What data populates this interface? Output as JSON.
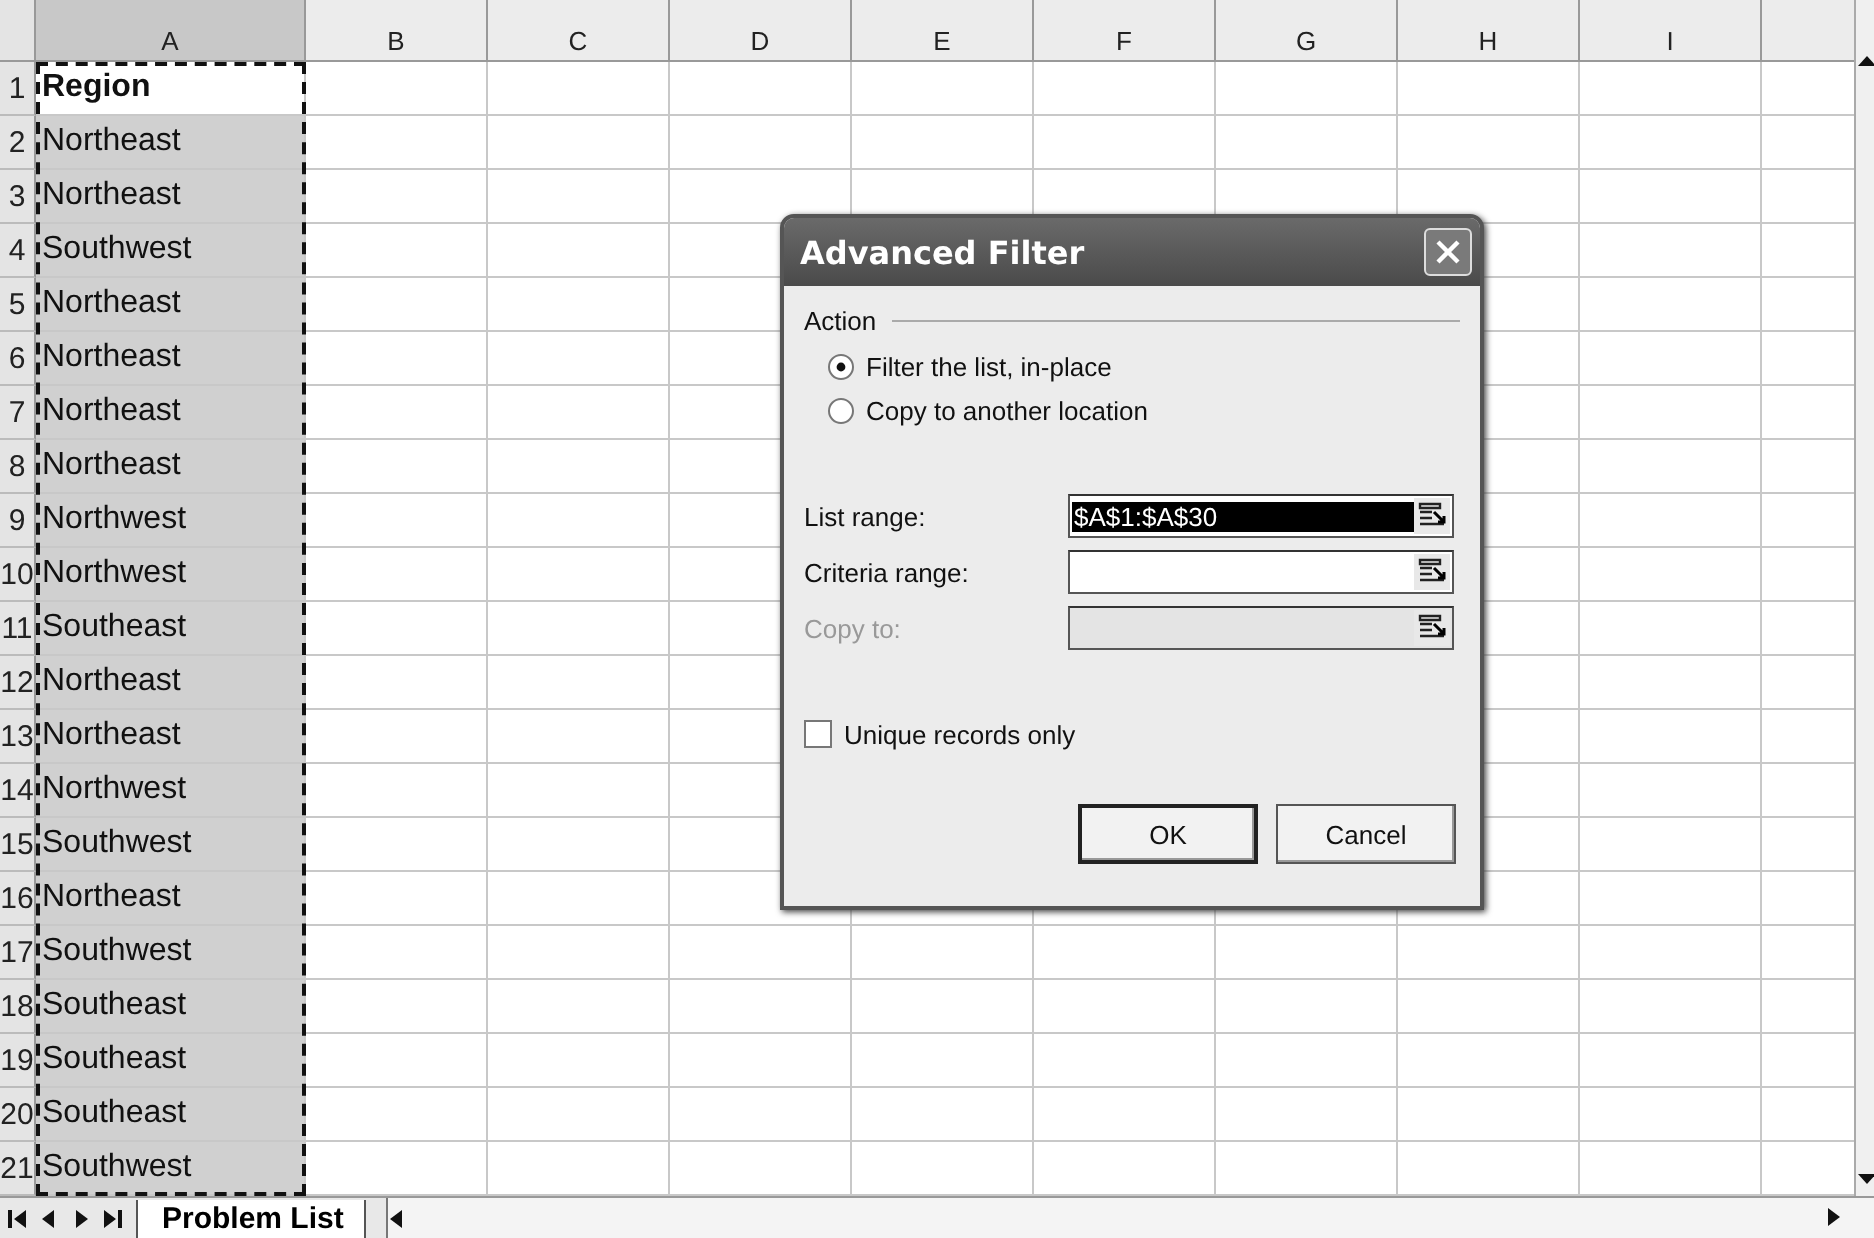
{
  "columns": [
    {
      "label": "A",
      "selected": true
    },
    {
      "label": "B",
      "selected": false
    },
    {
      "label": "C",
      "selected": false
    },
    {
      "label": "D",
      "selected": false
    },
    {
      "label": "E",
      "selected": false
    },
    {
      "label": "F",
      "selected": false
    },
    {
      "label": "G",
      "selected": false
    },
    {
      "label": "H",
      "selected": false
    },
    {
      "label": "I",
      "selected": false
    }
  ],
  "rows": [
    {
      "number": "1",
      "value": "Region",
      "kind": "header",
      "highlighted": false
    },
    {
      "number": "2",
      "value": "Northeast",
      "kind": "data",
      "highlighted": true
    },
    {
      "number": "3",
      "value": "Northeast",
      "kind": "data",
      "highlighted": true
    },
    {
      "number": "4",
      "value": "Southwest",
      "kind": "data",
      "highlighted": true
    },
    {
      "number": "5",
      "value": "Northeast",
      "kind": "data",
      "highlighted": true
    },
    {
      "number": "6",
      "value": "Northeast",
      "kind": "data",
      "highlighted": true
    },
    {
      "number": "7",
      "value": "Northeast",
      "kind": "data",
      "highlighted": true
    },
    {
      "number": "8",
      "value": "Northeast",
      "kind": "data",
      "highlighted": true
    },
    {
      "number": "9",
      "value": "Northwest",
      "kind": "data",
      "highlighted": true
    },
    {
      "number": "10",
      "value": "Northwest",
      "kind": "data",
      "highlighted": true
    },
    {
      "number": "11",
      "value": "Southeast",
      "kind": "data",
      "highlighted": true
    },
    {
      "number": "12",
      "value": "Northeast",
      "kind": "data",
      "highlighted": true
    },
    {
      "number": "13",
      "value": "Northeast",
      "kind": "data",
      "highlighted": true
    },
    {
      "number": "14",
      "value": "Northwest",
      "kind": "data",
      "highlighted": true
    },
    {
      "number": "15",
      "value": "Southwest",
      "kind": "data",
      "highlighted": true
    },
    {
      "number": "16",
      "value": "Northeast",
      "kind": "data",
      "highlighted": true
    },
    {
      "number": "17",
      "value": "Southwest",
      "kind": "data",
      "highlighted": true
    },
    {
      "number": "18",
      "value": "Southeast",
      "kind": "data",
      "highlighted": true
    },
    {
      "number": "19",
      "value": "Southeast",
      "kind": "data",
      "highlighted": true
    },
    {
      "number": "20",
      "value": "Southeast",
      "kind": "data",
      "highlighted": true
    },
    {
      "number": "21",
      "value": "Southwest",
      "kind": "data",
      "highlighted": true
    }
  ],
  "sheet_tabs": [
    {
      "label": "Problem List",
      "selected": true
    }
  ],
  "dialog": {
    "title": "Advanced Filter",
    "group": "Action",
    "radios": [
      {
        "label": "Filter the list, in-place",
        "selected": true
      },
      {
        "label": "Copy to another location",
        "selected": false
      }
    ],
    "fields": [
      {
        "label": "List range:",
        "value": "$A$1:$A$30",
        "disabled": false,
        "value_selected": true
      },
      {
        "label": "Criteria range:",
        "disabled": false
      },
      {
        "label": "Copy to:",
        "disabled": true
      }
    ],
    "checkbox": {
      "label": "Unique records only",
      "checked": false
    },
    "buttons": [
      {
        "label": "OK",
        "default": true
      },
      {
        "label": "Cancel",
        "default": false
      }
    ]
  }
}
